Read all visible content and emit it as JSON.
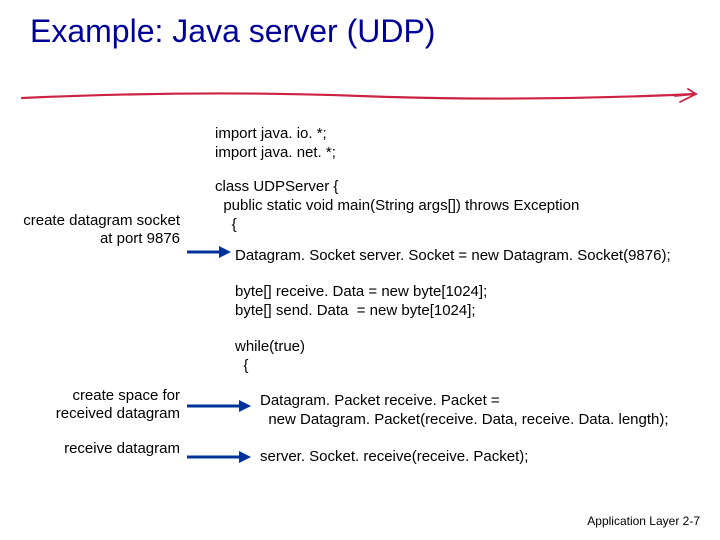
{
  "title": "Example: Java server (UDP)",
  "code": {
    "imports": "import java. io. *;\nimport java. net. *;",
    "class_head": "class UDPServer {\n  public static void main(String args[]) throws Exception\n    {",
    "socket_line": "Datagram. Socket server. Socket = new Datagram. Socket(9876);",
    "byte_arrays": "byte[] receive. Data = new byte[1024];\nbyte[] send. Data  = new byte[1024];",
    "while_head": "while(true)\n  {",
    "packet_lines": "Datagram. Packet receive. Packet =\n  new Datagram. Packet(receive. Data, receive. Data. length);",
    "receive_line": "server. Socket. receive(receive. Packet);"
  },
  "annotations": {
    "create_socket": "create\ndatagram socket\nat port 9876",
    "create_space": "create space for\nreceived datagram",
    "receive": "receive\ndatagram"
  },
  "footer": "Application Layer 2-7"
}
